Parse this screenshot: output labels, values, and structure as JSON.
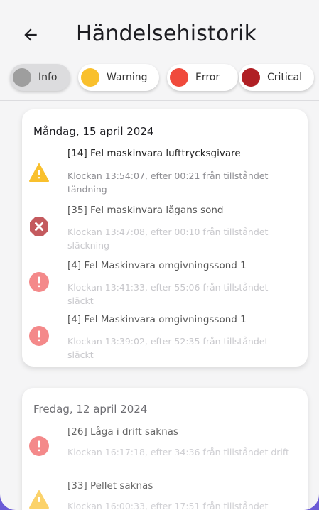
{
  "header": {
    "title": "Händelsehistorik"
  },
  "filters": [
    {
      "label": "Info",
      "color": "#9e9e9e",
      "selected": true
    },
    {
      "label": "Warning",
      "color": "#f9c02d",
      "selected": false
    },
    {
      "label": "Error",
      "color": "#f04a3c",
      "selected": false
    },
    {
      "label": "Critical",
      "color": "#b01f24",
      "selected": false
    }
  ],
  "days": [
    {
      "date": "Måndag, 15 april 2024",
      "events": [
        {
          "icon": "warning-icon",
          "title": "[14] Fel maskinvara lufttrycksgivare",
          "sub": "Klockan 13:54:07, efter 00:21 från tillståndet tändning"
        },
        {
          "icon": "critical-icon",
          "title": "[35] Fel maskinvara lågans sond",
          "sub": "Klockan 13:47:08, efter 00:10 från tillståndet släckning"
        },
        {
          "icon": "error-icon",
          "title": "[4] Fel Maskinvara omgivningssond 1",
          "sub": "Klockan 13:41:33, efter 55:06 från tillståndet släckt"
        },
        {
          "icon": "error-icon",
          "title": "[4] Fel Maskinvara omgivningssond 1",
          "sub": "Klockan 13:39:02, efter 52:35 från tillståndet släckt"
        }
      ]
    },
    {
      "date": "Fredag, 12 april 2024",
      "events": [
        {
          "icon": "error-icon",
          "title": "[26] Låga i drift saknas",
          "sub": "Klockan 16:17:18, efter 34:36 från tillståndet drift"
        },
        {
          "icon": "warning-icon",
          "title": "[33] Pellet saknas",
          "sub": "Klockan 16:00:33, efter 17:51 från tillståndet"
        }
      ]
    }
  ]
}
